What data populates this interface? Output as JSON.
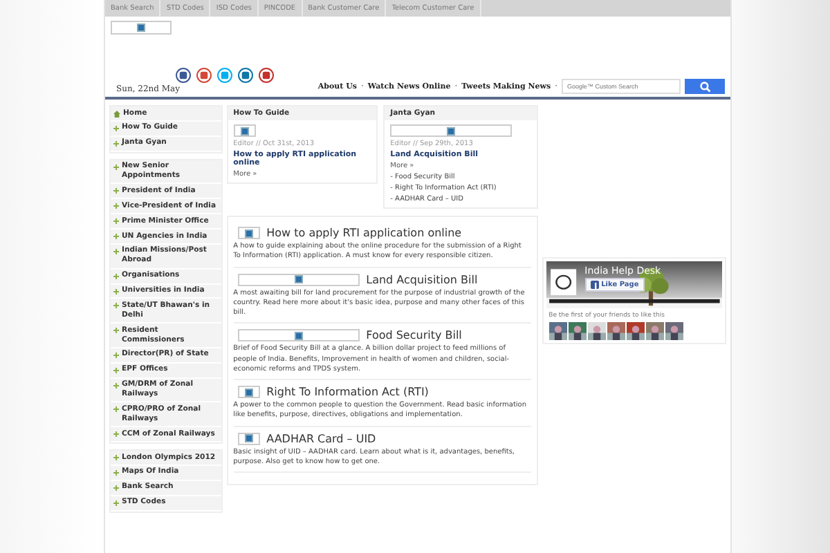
{
  "top_nav": [
    {
      "label": "Bank Search"
    },
    {
      "label": "STD Codes"
    },
    {
      "label": "ISD Codes"
    },
    {
      "label": "PINCODE"
    },
    {
      "label": "Bank Customer Care"
    },
    {
      "label": "Telecom Customer Care"
    }
  ],
  "header": {
    "date": "Sun, 22nd May",
    "links": [
      {
        "label": "About Us",
        "separator": "·"
      },
      {
        "label": "Watch News Online",
        "separator": "·"
      },
      {
        "label": "Tweets Making News",
        "separator": "·"
      }
    ],
    "search": {
      "placeholder": "Google™ Custom Search"
    }
  },
  "sidebar": {
    "groups": [
      [
        {
          "label": "Home",
          "kind": "home"
        },
        {
          "label": "How To Guide",
          "kind": "link"
        },
        {
          "label": "Janta Gyan",
          "kind": "link"
        }
      ],
      [
        {
          "label": "New Senior Appointments",
          "kind": "link"
        },
        {
          "label": "President of India",
          "kind": "link"
        },
        {
          "label": "Vice-President of India",
          "kind": "link"
        },
        {
          "label": "Prime Minister Office",
          "kind": "link"
        },
        {
          "label": "UN Agencies in India",
          "kind": "link"
        },
        {
          "label": "Indian Missions/Post Abroad",
          "kind": "link"
        },
        {
          "label": "Organisations",
          "kind": "link"
        },
        {
          "label": "Universities in India",
          "kind": "link"
        },
        {
          "label": "State/UT Bhawan's in Delhi",
          "kind": "link"
        },
        {
          "label": "Resident Commissioners",
          "kind": "link"
        },
        {
          "label": "Director(PR) of State",
          "kind": "link"
        },
        {
          "label": "EPF Offices",
          "kind": "link"
        },
        {
          "label": "GM/DRM of Zonal Railways",
          "kind": "link"
        },
        {
          "label": "CPRO/PRO of Zonal Railways",
          "kind": "link"
        },
        {
          "label": "CCM of Zonal Railways",
          "kind": "link"
        }
      ],
      [
        {
          "label": "London Olympics 2012",
          "kind": "link"
        },
        {
          "label": "Maps Of India",
          "kind": "link"
        },
        {
          "label": "Bank Search",
          "kind": "link"
        },
        {
          "label": "STD Codes",
          "kind": "link"
        }
      ]
    ]
  },
  "boxes": [
    {
      "heading": "How To Guide",
      "meta": "Editor // Oct 31st, 2013",
      "title": "How to apply RTI application online",
      "more": "More »"
    },
    {
      "heading": "Janta Gyan",
      "meta": "Editor // Sep 29th, 2013",
      "title": "Land Acquisition Bill",
      "more": "More »",
      "list": [
        "- Food Security Bill",
        "- Right To Information Act (RTI)",
        "- AADHAR Card – UID"
      ]
    }
  ],
  "articles": [
    {
      "title": "How to apply RTI application online",
      "kind": "small",
      "text": "A how to guide explaining about the online procedure for the submission of a Right To Information (RTI) application. A must know for every responsible citizen."
    },
    {
      "title": "Land Acquisition Bill",
      "kind": "wide",
      "text": "A most awaiting bill for land procurement for the purpose of industrial growth of the country. Read here more about it's basic idea, purpose and many other faces of this bill."
    },
    {
      "title": "Food Security Bill",
      "kind": "wide",
      "text": "Brief of Food Security Bill at a glance. A billion dollar project to feed millions of people of India. Benefits, Improvement in health of women and children, social-economic reforms and TPDS system."
    },
    {
      "title": "Right To Information Act (RTI)",
      "kind": "small",
      "text": "A power to the common people to question the Government. Read basic information like benefits, purpose, directives, obligations and implementation."
    },
    {
      "title": "AADHAR Card – UID",
      "kind": "small",
      "text": "Basic insight of UID – AADHAR card. Learn about what is it, advantages, benefits, purpose. Also get to know how to get one."
    }
  ],
  "facebook": {
    "page_name": "India Help Desk",
    "like_button": "Like Page",
    "friends_text": "Be the first of your friends to like this"
  }
}
